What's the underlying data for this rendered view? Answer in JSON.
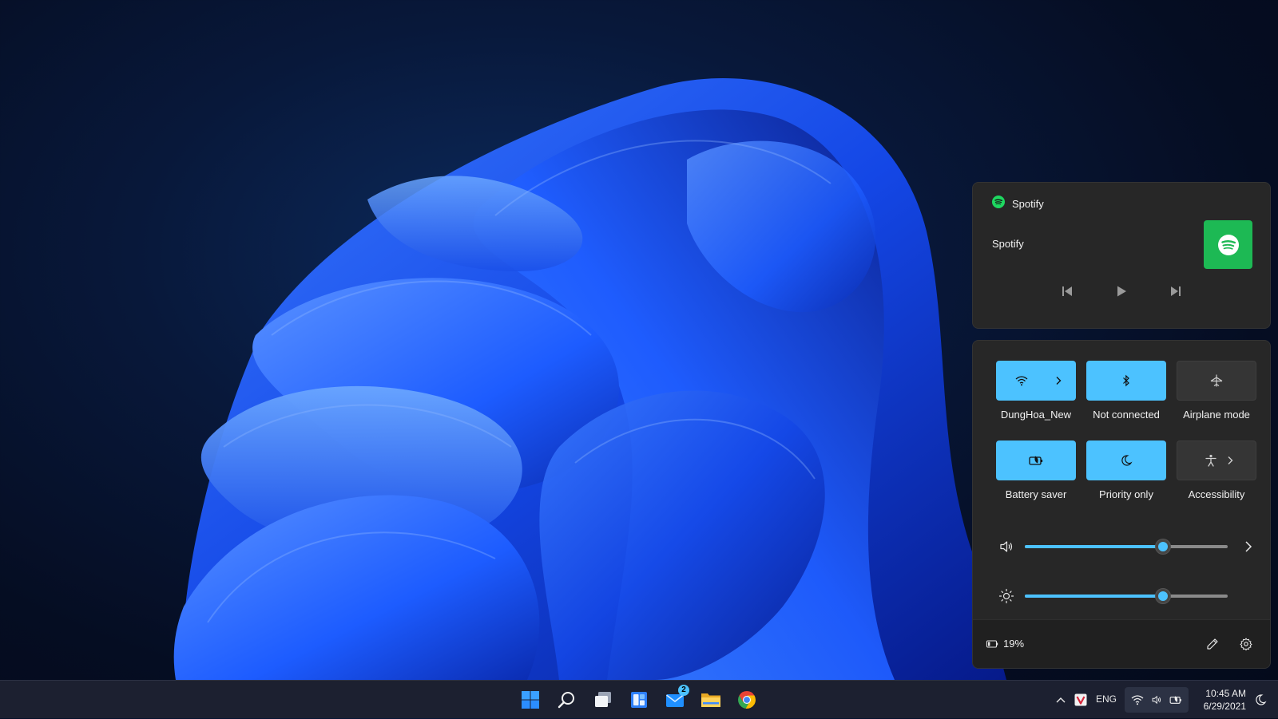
{
  "media": {
    "app_name": "Spotify",
    "track_title": "Spotify",
    "app_icon": "spotify-icon",
    "controls": [
      "previous-icon",
      "play-icon",
      "next-icon"
    ]
  },
  "quick_settings": {
    "tiles": [
      {
        "label": "DungHoa_New",
        "icon": "wifi-icon",
        "active": true,
        "has_chevron": true
      },
      {
        "label": "Not connected",
        "icon": "bluetooth-icon",
        "active": true,
        "has_chevron": false
      },
      {
        "label": "Airplane mode",
        "icon": "airplane-icon",
        "active": false,
        "has_chevron": false
      },
      {
        "label": "Battery saver",
        "icon": "battery-saver-icon",
        "active": true,
        "has_chevron": false
      },
      {
        "label": "Priority only",
        "icon": "moon-icon",
        "active": true,
        "has_chevron": false
      },
      {
        "label": "Accessibility",
        "icon": "accessibility-icon",
        "active": false,
        "has_chevron": true
      }
    ],
    "volume_level": 0.68,
    "brightness_level": 0.68,
    "accent_color": "#4cc2ff"
  },
  "footer": {
    "battery_text": "19%",
    "edit_icon": "pencil-icon",
    "settings_icon": "gear-icon"
  },
  "taskbar": {
    "apps": [
      "start-icon",
      "search-icon",
      "task-view-icon",
      "widgets-icon",
      "mail-icon",
      "file-explorer-icon",
      "chrome-icon"
    ],
    "mail_badge": "2",
    "language": "ENG",
    "time": "10:45 AM",
    "date": "6/29/2021"
  }
}
